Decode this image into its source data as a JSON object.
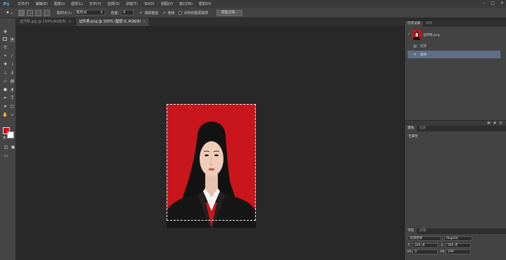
{
  "app": {
    "logo": "Ps"
  },
  "menu": [
    "文件(F)",
    "编辑(E)",
    "图像(I)",
    "图层(L)",
    "文字(Y)",
    "选择(S)",
    "滤镜(T)",
    "3D(D)",
    "视图(V)",
    "窗口(W)",
    "帮助(H)"
  ],
  "window_controls": {
    "minimize": "–",
    "restore": "□",
    "close": "✕"
  },
  "options": {
    "sample_size_label": "取样大小:",
    "sample_size_value": "取样点",
    "tolerance_label": "容差:",
    "tolerance_value": "0",
    "antialias_label": "消除锯齿",
    "contiguous_label": "连续",
    "sample_all_label": "对所有图层取样",
    "refine_edge_label": "调整边缘..."
  },
  "tabs": [
    {
      "label": "证件照.jpg @ 234%(RGB/8)",
      "close": "×"
    },
    {
      "label": "证件照.png @ 100% (图层 0, RGB/8)",
      "close": "×"
    }
  ],
  "history_panel": {
    "tabs": [
      "历史记录",
      "动作"
    ],
    "snapshot_label": "证件照.png",
    "steps": [
      "打开",
      "魔棒"
    ],
    "selected_step": 1,
    "footer_icons": [
      "new-document-from-state-icon",
      "camera-icon",
      "trash-icon"
    ]
  },
  "properties_panel": {
    "tabs": [
      "属性",
      "信息"
    ],
    "content": "无属性"
  },
  "character_panel": {
    "tabs": [
      "字符",
      "段落"
    ],
    "font_family": "思源黑体",
    "font_style": "Regular",
    "font_size": "240 点",
    "leading": "282 点",
    "kerning": "0",
    "tracking": "100"
  },
  "colors": {
    "foreground": "#cc1118",
    "background": "#ffffff",
    "photo_bg": "#c8161c"
  }
}
